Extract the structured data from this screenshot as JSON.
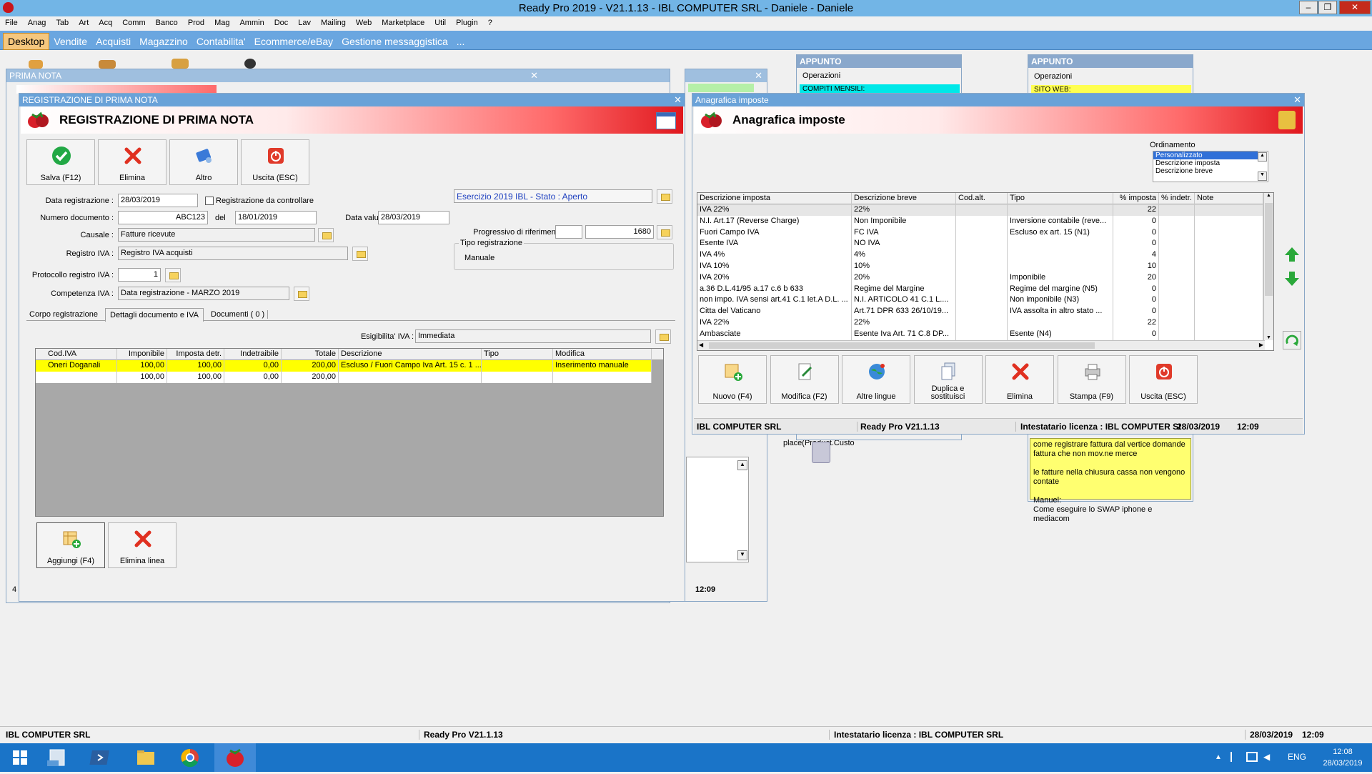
{
  "window": {
    "title": "Ready Pro 2019 - V21.1.13 - IBL COMPUTER SRL - Daniele - Daniele",
    "controls": [
      "–",
      "❐",
      "✕"
    ]
  },
  "menu": [
    "File",
    "Anag",
    "Tab",
    "Art",
    "Acq",
    "Comm",
    "Banco",
    "Prod",
    "Mag",
    "Ammin",
    "Doc",
    "Lav",
    "Mailing",
    "Web",
    "Marketplace",
    "Util",
    "Plugin",
    "?"
  ],
  "tabs": [
    "Desktop",
    "Vendite",
    "Acquisti",
    "Magazzino",
    "Contabilita'",
    "Ecommerce/eBay",
    "Gestione messaggistica",
    "..."
  ],
  "bg_windows": {
    "prima_nota": "PRIMA NOTA",
    "appunto1_title": "APPUNTO",
    "appunto1_ops": "Operazioni",
    "appunto1_item": "COMPITI MENSILI:",
    "appunto2_title": "APPUNTO",
    "appunto2_ops": "Operazioni",
    "appunto2_item": "SITO WEB:",
    "note_lines": [
      "come registrare fattura dal vertice domande fattura che non mov.ne merce",
      "le fatture nella chiusura cassa non vengono contate",
      "Manuel:",
      "Come eseguire lo SWAP iphone e mediacom"
    ],
    "marketplace_label": "place(Product.Custo",
    "time": "12:09"
  },
  "registrazione": {
    "title_bar": "REGISTRAZIONE DI PRIMA NOTA",
    "banner": "REGISTRAZIONE DI PRIMA NOTA",
    "buttons": {
      "salva": "Salva (F12)",
      "elimina": "Elimina",
      "altro": "Altro",
      "uscita": "Uscita (ESC)"
    },
    "labels": {
      "data_reg": "Data registrazione :",
      "da_controllare": "Registrazione da controllare",
      "num_doc": "Numero documento :",
      "del": "del",
      "data_valuta": "Data valuta :",
      "causale": "Causale :",
      "registro_iva": "Registro IVA :",
      "protocollo": "Protocollo registro IVA :",
      "competenza": "Competenza IVA :",
      "progressivo": "Progressivo di riferimento :",
      "tipo_reg": "Tipo registrazione",
      "esigibilita": "Esigibilita' IVA :"
    },
    "values": {
      "data_reg": "28/03/2019",
      "num_doc": "ABC123",
      "del": "18/01/2019",
      "data_valuta": "28/03/2019",
      "esercizio": "Esercizio 2019 IBL - Stato : Aperto",
      "causale": "Fatture ricevute",
      "registro_iva": "Registro IVA acquisti",
      "protocollo": "1",
      "competenza": "Data registrazione - MARZO 2019",
      "progressivo": "1680",
      "tipo_reg": "Manuale",
      "esigibilita": "Immediata"
    },
    "subtabs": [
      "Corpo registrazione",
      "Dettagli documento e IVA",
      "Documenti ( 0 )"
    ],
    "grid": {
      "columns": [
        "Cod.IVA",
        "Imponibile",
        "Imposta detr.",
        "Indetraibile",
        "Totale",
        "Descrizione",
        "Tipo",
        "Modifica"
      ],
      "rows": [
        [
          "Oneri Doganali",
          "100,00",
          "100,00",
          "0,00",
          "200,00",
          "Escluso / Fuori Campo Iva Art. 15 c. 1 ...",
          "",
          "Inserimento manuale"
        ],
        [
          "",
          "100,00",
          "100,00",
          "0,00",
          "200,00",
          "",
          "",
          ""
        ]
      ]
    },
    "bottom_buttons": {
      "aggiungi": "Aggiungi (F4)",
      "elimina_linea": "Elimina linea"
    }
  },
  "imposte": {
    "title_bar": "Anagrafica imposte",
    "banner": "Anagrafica imposte",
    "ordinamento_label": "Ordinamento",
    "ordinamento": [
      "Personalizzato",
      "Descrizione imposta",
      "Descrizione breve"
    ],
    "columns": [
      "Descrizione imposta",
      "Descrizione breve",
      "Cod.alt.",
      "Tipo",
      "% imposta",
      "% indetr.",
      "Note"
    ],
    "rows": [
      [
        "IVA 22%",
        "22%",
        "",
        "",
        "22",
        "",
        ""
      ],
      [
        "N.I. Art.17 (Reverse Charge)",
        "Non Imponibile",
        "",
        "Inversione contabile (reve...",
        "0",
        "",
        ""
      ],
      [
        "Fuori Campo IVA",
        "FC IVA",
        "",
        "Escluso ex art. 15 (N1)",
        "0",
        "",
        ""
      ],
      [
        "Esente IVA",
        "NO IVA",
        "",
        "",
        "0",
        "",
        ""
      ],
      [
        "IVA 4%",
        "4%",
        "",
        "",
        "4",
        "",
        ""
      ],
      [
        "IVA 10%",
        "10%",
        "",
        "",
        "10",
        "",
        ""
      ],
      [
        "IVA 20%",
        "20%",
        "",
        "Imponibile",
        "20",
        "",
        ""
      ],
      [
        "a.36 D.L.41/95 a.17 c.6 b 633",
        "Regime del Margine",
        "",
        "Regime del margine (N5)",
        "0",
        "",
        ""
      ],
      [
        "non impo. IVA sensi art.41 C.1 let.A D.L. ...",
        "N.I. ARTICOLO 41 C.1 L....",
        "",
        "Non imponibile (N3)",
        "0",
        "",
        ""
      ],
      [
        "Citta del Vaticano",
        "Art.71 DPR 633 26/10/19...",
        "",
        "IVA assolta in altro stato ...",
        "0",
        "",
        ""
      ],
      [
        "IVA 22%",
        "22%",
        "",
        "",
        "22",
        "",
        ""
      ],
      [
        "Ambasciate",
        "Esente Iva Art. 71 C.8 DP...",
        "",
        "Esente (N4)",
        "0",
        "",
        ""
      ]
    ],
    "buttons": [
      "Nuovo (F4)",
      "Modifica (F2)",
      "Altre lingue",
      "Duplica e sostituisci",
      "Elimina",
      "Stampa (F9)",
      "Uscita (ESC)"
    ],
    "status": {
      "company": "IBL COMPUTER SRL",
      "version": "Ready Pro V21.1.13",
      "license": "Intestatario licenza : IBL COMPUTER SI",
      "date": "28/03/2019",
      "time": "12:09"
    }
  },
  "main_status": {
    "company": "IBL COMPUTER SRL",
    "version": "Ready Pro V21.1.13",
    "license": "Intestatario licenza : IBL COMPUTER SRL",
    "date": "28/03/2019",
    "time": "12:09"
  },
  "taskbar": {
    "lang": "ENG",
    "time": "12:08",
    "date": "28/03/2019"
  },
  "colors": {
    "titlebar": "#72b5e6",
    "tabbar": "#6aa6e0",
    "active_tab": "#f5c77e",
    "selected_row": "#ffff00",
    "taskbar": "#1a74c8"
  }
}
